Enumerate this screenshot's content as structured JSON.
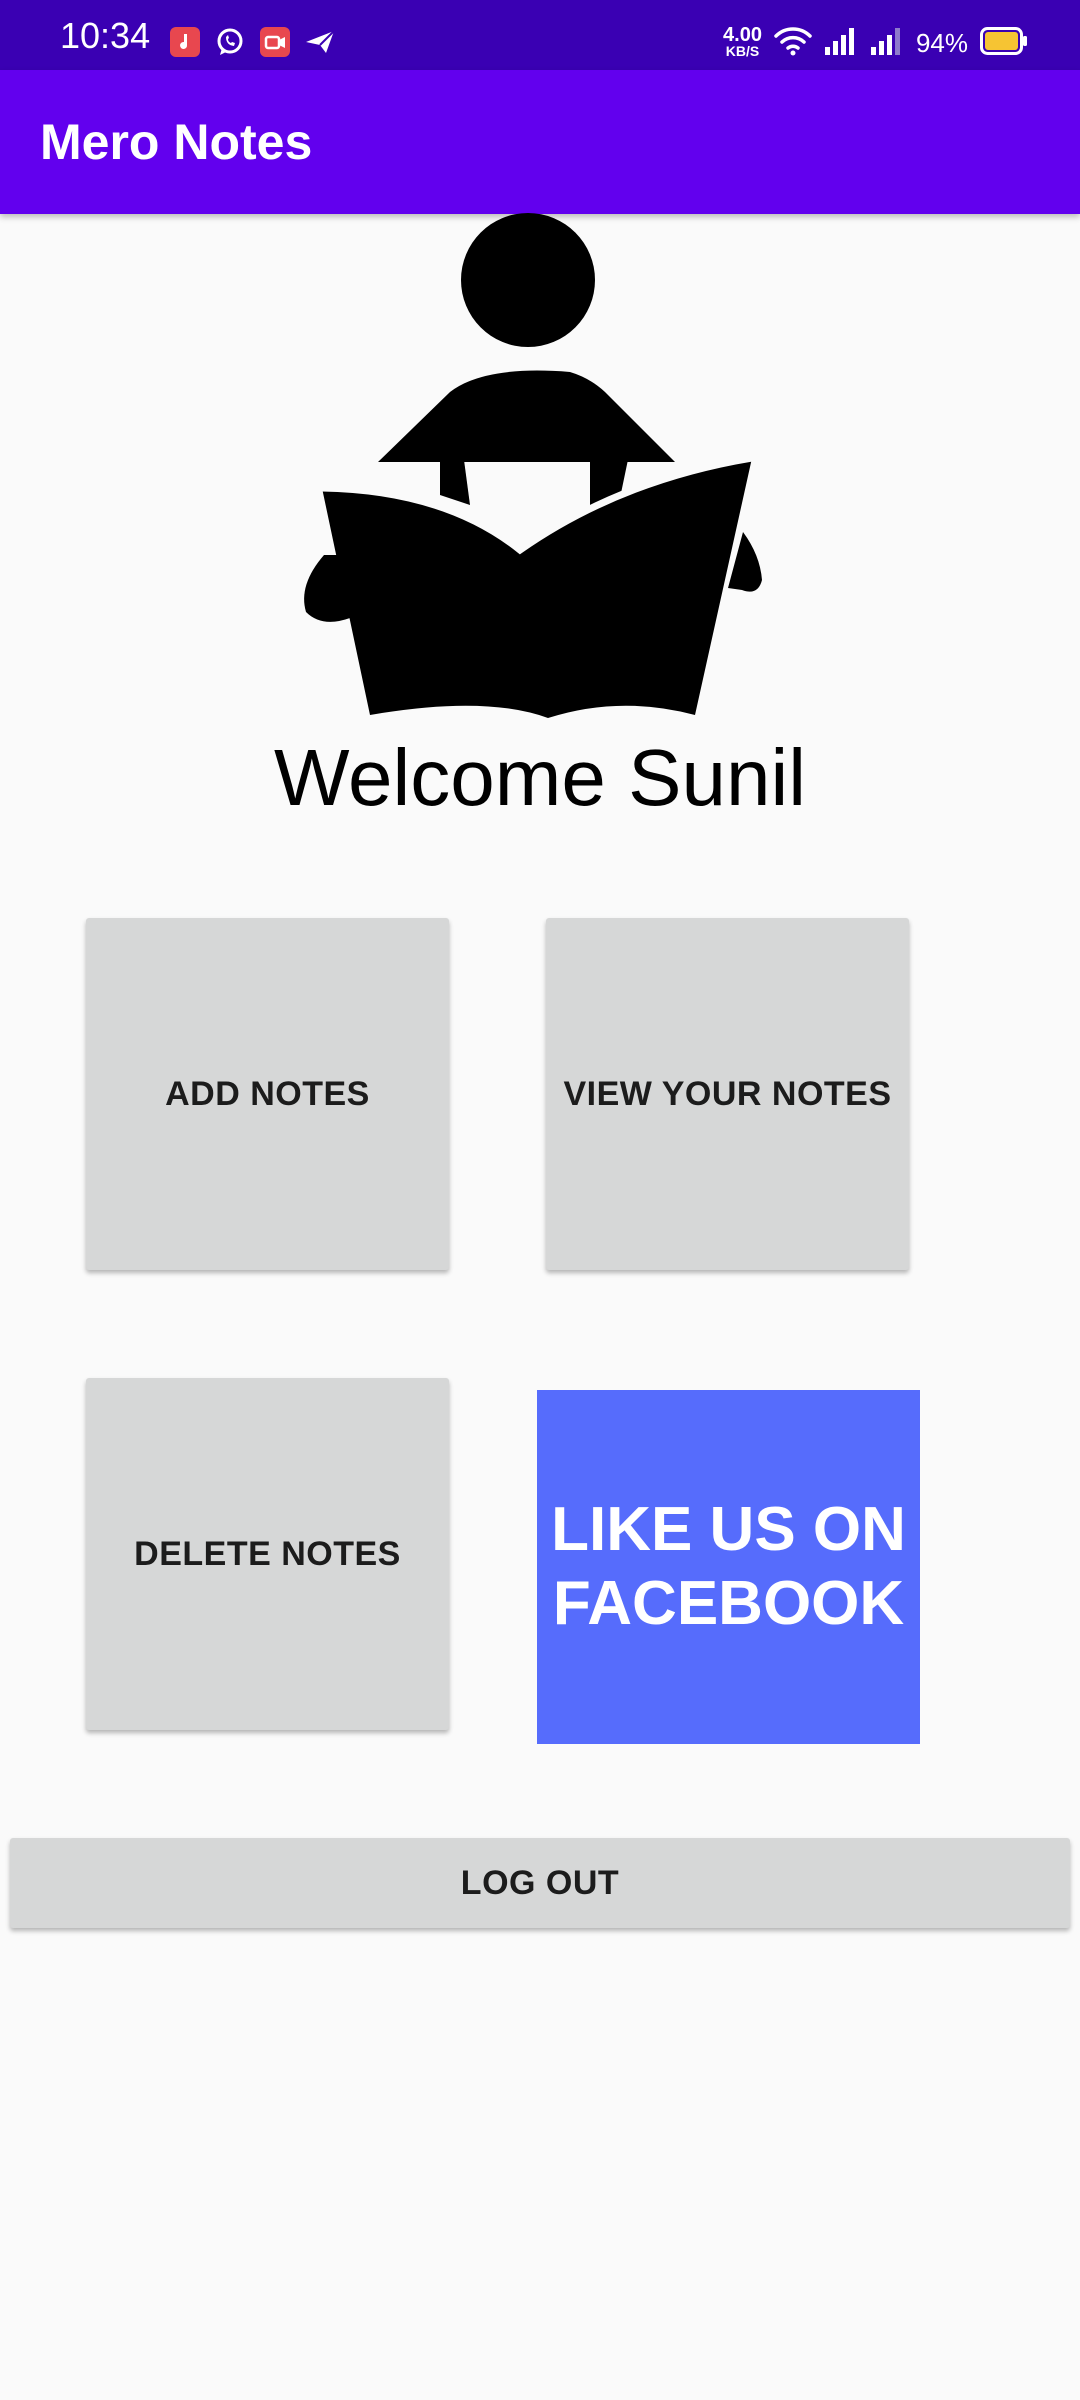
{
  "status_bar": {
    "time": "10:34",
    "net_speed_value": "4.00",
    "net_speed_unit": "KB/S",
    "battery_percent": "94%",
    "notification_icons": [
      "music-app-icon",
      "whatsapp-icon",
      "video-app-icon",
      "send-icon"
    ],
    "battery_color": "#f6c433"
  },
  "app_bar": {
    "title": "Mero Notes",
    "color": "#6200ee"
  },
  "main": {
    "welcome_text": "Welcome Sunil",
    "buttons": {
      "add_notes": "ADD NOTES",
      "view_notes": "VIEW YOUR NOTES",
      "delete_notes": "DELETE NOTES",
      "facebook": "LIKE US ON FACEBOOK",
      "logout": "LOG OUT"
    },
    "facebook_color": "#566cfc"
  }
}
